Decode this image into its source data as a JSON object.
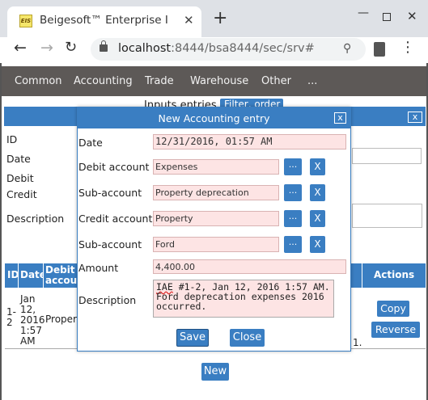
{
  "browser": {
    "tab_title": "Beigesoft™ Enterprise Info",
    "favicon_text": "EIS",
    "url_host": "localhost",
    "url_rest": ":8444/bsa8444/sec/srv#"
  },
  "menu": [
    "Common",
    "Accounting",
    "Trade",
    "Warehouse",
    "Other",
    "..."
  ],
  "page": {
    "title": "Inputs entries",
    "filter_button": "Filter, order",
    "background_labels": [
      "ID",
      "Date",
      "Debit",
      "Credit",
      "Description"
    ],
    "table_headers": [
      "ID",
      "Date",
      "Debit account",
      "Actions"
    ],
    "row": {
      "id": "1-2",
      "date": "Jan 12, 2016 1:57 AM",
      "debit": "Propert",
      "trailing": "1."
    },
    "copy_button": "Copy",
    "reverse_button": "Reverse",
    "new_button": "New"
  },
  "dialog": {
    "title": "New Accounting entry",
    "close_glyph": "x",
    "fields": {
      "date_label": "Date",
      "date_value": "12/31/2016, 01:57 AM",
      "debit_label": "Debit account",
      "debit_value": "Expenses",
      "debit_sub_label": "Sub-account",
      "debit_sub_value": "Property deprecation",
      "credit_label": "Credit account",
      "credit_value": "Property",
      "credit_sub_label": "Sub-account",
      "credit_sub_value": "Ford",
      "amount_label": "Amount",
      "amount_value": "4,400.00",
      "description_label": "Description",
      "description_iae": "IAE",
      "description_value": " #1-2, Jan 12, 2016 1:57 AM. Ford deprecation expenses 2016 occurred."
    },
    "pick_label": "...",
    "clear_label": "X",
    "save_button": "Save",
    "close_button": "Close"
  }
}
